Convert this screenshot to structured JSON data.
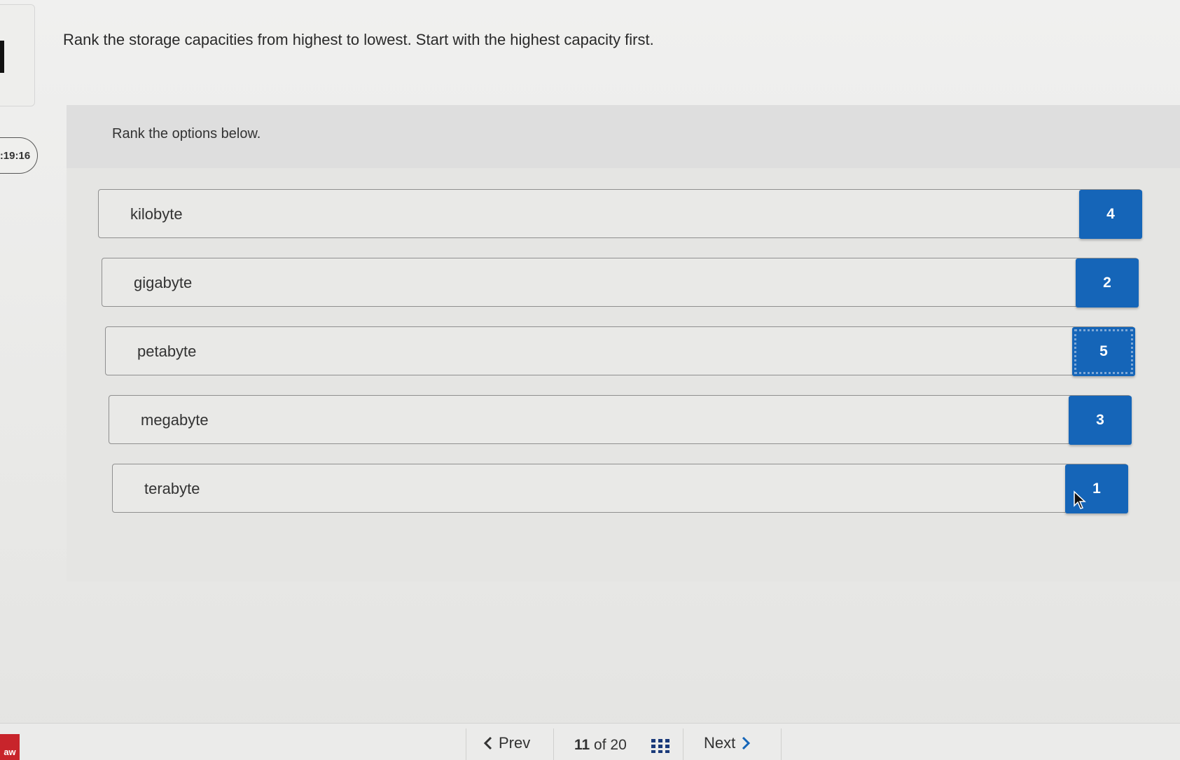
{
  "timer": {
    "value": ":19:16"
  },
  "question": {
    "text": "Rank the storage capacities from highest to lowest. Start with the highest capacity first."
  },
  "ranking": {
    "instruction": "Rank the options below.",
    "items": [
      {
        "label": "kilobyte",
        "rank": "4"
      },
      {
        "label": "gigabyte",
        "rank": "2"
      },
      {
        "label": "petabyte",
        "rank": "5"
      },
      {
        "label": "megabyte",
        "rank": "3"
      },
      {
        "label": "terabyte",
        "rank": "1"
      }
    ]
  },
  "navigation": {
    "prev_label": "Prev",
    "current_page": "11",
    "of_label": "of",
    "total_pages": "20",
    "next_label": "Next"
  },
  "brand": {
    "badge_text": "aw"
  },
  "colors": {
    "rank_box": "#1565b8",
    "badge": "#c8242b"
  }
}
